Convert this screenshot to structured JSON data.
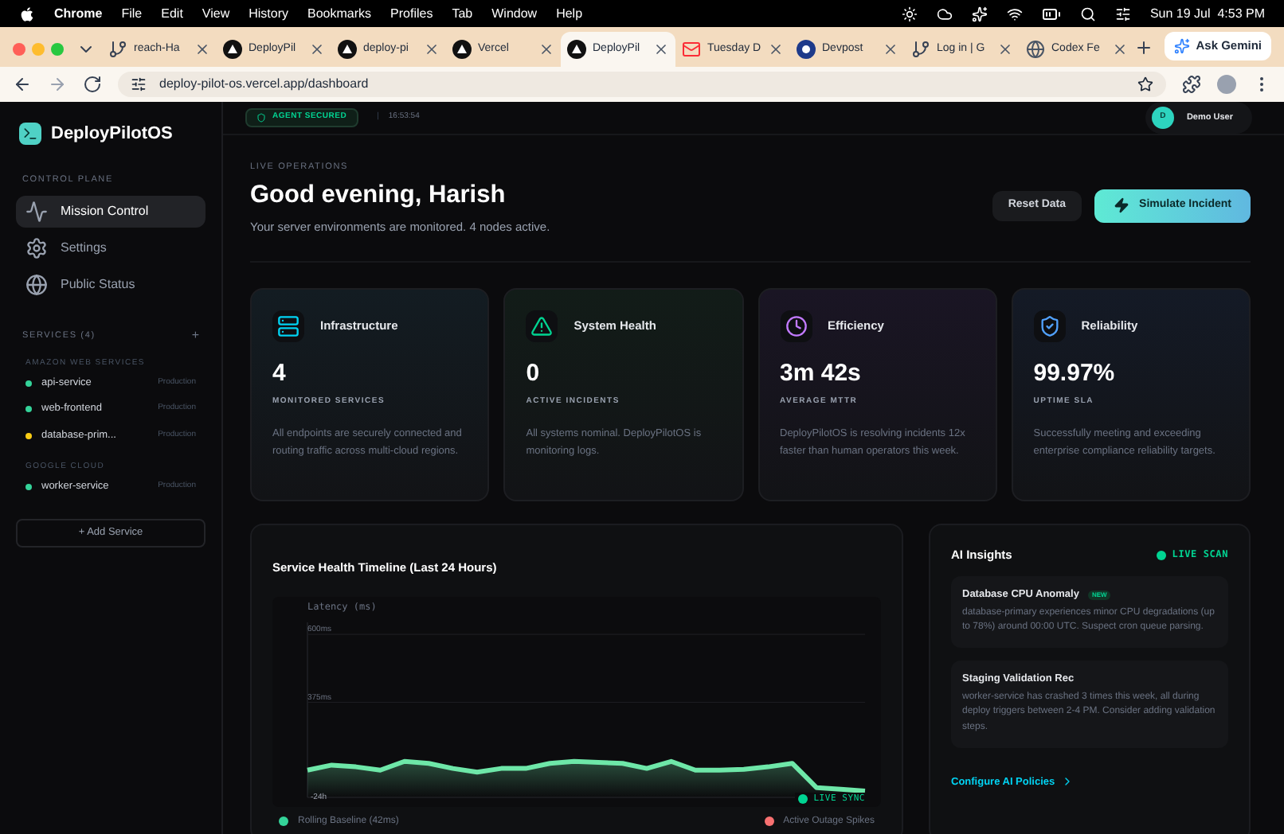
{
  "menu_bar": {
    "app": "Chrome",
    "items": [
      "File",
      "Edit",
      "View",
      "History",
      "Bookmarks",
      "Profiles",
      "Tab",
      "Window",
      "Help"
    ],
    "clock": "Sun 19 Jul  4:53 PM"
  },
  "browser": {
    "tabs": [
      {
        "label": "reach-Ha",
        "selected": false,
        "kind": "repo"
      },
      {
        "label": "DeployPil",
        "selected": false,
        "kind": "triangle"
      },
      {
        "label": "deploy-pi",
        "selected": false,
        "kind": "triangle"
      },
      {
        "label": "Vercel",
        "selected": false,
        "kind": "triangle"
      },
      {
        "label": "DeployPil",
        "selected": true,
        "kind": "triangle"
      },
      {
        "label": "Tuesday D",
        "selected": false,
        "kind": "mail"
      },
      {
        "label": "Devpost",
        "selected": false,
        "kind": "letter"
      },
      {
        "label": "Log in | G",
        "selected": false,
        "kind": "repo"
      },
      {
        "label": "Codex Fe",
        "selected": false,
        "kind": "globe"
      }
    ],
    "gemini": "Ask Gemini",
    "url": "deploy-pilot-os.vercel.app/dashboard"
  },
  "sidebar": {
    "logo": "DeployPilotOS",
    "section": "CONTROL PLANE",
    "nav": [
      {
        "label": "Mission Control",
        "selected": true,
        "kind": "activity"
      },
      {
        "label": "Settings",
        "selected": false,
        "kind": "gear"
      },
      {
        "label": "Public Status",
        "selected": false,
        "kind": "globe"
      }
    ],
    "services_title": "SERVICES (4)",
    "add_symbol": "+",
    "groups": [
      {
        "name": "AMAZON WEB SERVICES",
        "services": [
          {
            "name": "api-service",
            "env": "Production",
            "color": "#34d399"
          },
          {
            "name": "web-frontend",
            "env": "Production",
            "color": "#34d399"
          },
          {
            "name": "database-prim...",
            "env": "Production",
            "color": "#facc15"
          }
        ]
      },
      {
        "name": "GOOGLE CLOUD",
        "services": [
          {
            "name": "worker-service",
            "env": "Production",
            "color": "#34d399"
          }
        ]
      }
    ],
    "add_service": "+ Add Service"
  },
  "header": {
    "badge": "AGENT SECURED",
    "separator": "|",
    "time": "16:53:54",
    "user_initial": "D",
    "user": "Demo User"
  },
  "hero": {
    "eyebrow": "LIVE OPERATIONS",
    "title": "Good evening, Harish",
    "subtitle": "Your server environments are monitored. 4 nodes active.",
    "buttons": [
      {
        "label": "Reset Data",
        "kind": "secondary"
      },
      {
        "label": "Simulate Incident",
        "kind": "primary"
      }
    ]
  },
  "cards": [
    {
      "kind": "server",
      "title": "Infrastructure",
      "value": "4",
      "caption": "MONITORED SERVICES",
      "text": "All endpoints are securely connected and routing traffic across multi-cloud regions."
    },
    {
      "kind": "alert",
      "title": "System Health",
      "value": "0",
      "caption": "ACTIVE INCIDENTS",
      "text": "All systems nominal. DeployPilotOS is monitoring logs."
    },
    {
      "kind": "clock",
      "title": "Efficiency",
      "value": "3m 42s",
      "caption": "AVERAGE MTTR",
      "text": "DeployPilotOS is resolving incidents 12x faster than human operators this week."
    },
    {
      "kind": "shield",
      "title": "Reliability",
      "value": "99.97%",
      "caption": "UPTIME SLA",
      "text": "Successfully meeting and exceeding enterprise compliance reliability targets."
    }
  ],
  "timeline": {
    "title": "Service Health Timeline (Last 24 Hours)",
    "live": "LIVE SYNC",
    "start_label": "-24h",
    "chart_data": {
      "type": "area",
      "ylabel": "Latency (ms)",
      "series": [
        {
          "color": "#6ee7a8",
          "values": [
            150,
            167,
            161,
            150,
            179,
            173,
            156,
            144,
            156,
            156,
            173,
            179,
            176,
            173,
            156,
            179,
            150,
            150,
            153,
            161,
            173,
            92,
            87,
            81
          ]
        }
      ],
      "ylim": [
        60,
        640
      ],
      "yticks": [
        {
          "value": 600,
          "label": "600ms"
        },
        {
          "value": 375,
          "label": "375ms"
        }
      ]
    },
    "legend": [
      {
        "label": "Rolling Baseline (42ms)",
        "color": "#34d399"
      },
      {
        "label": "Active Outage Spikes",
        "color": "#f87171"
      }
    ]
  },
  "insights": {
    "title": "AI Insights",
    "status": "LIVE SCAN",
    "items": [
      {
        "title": "Database CPU Anomaly",
        "badge": "NEW",
        "text": "database-primary experiences minor CPU degradations (up to 78%) around 00:00 UTC. Suspect cron queue parsing."
      },
      {
        "title": "Staging Validation Rec",
        "text": "worker-service has crashed 3 times this week, all during deploy triggers between 2-4 PM. Consider adding validation steps."
      }
    ],
    "link": "Configure AI Policies"
  }
}
